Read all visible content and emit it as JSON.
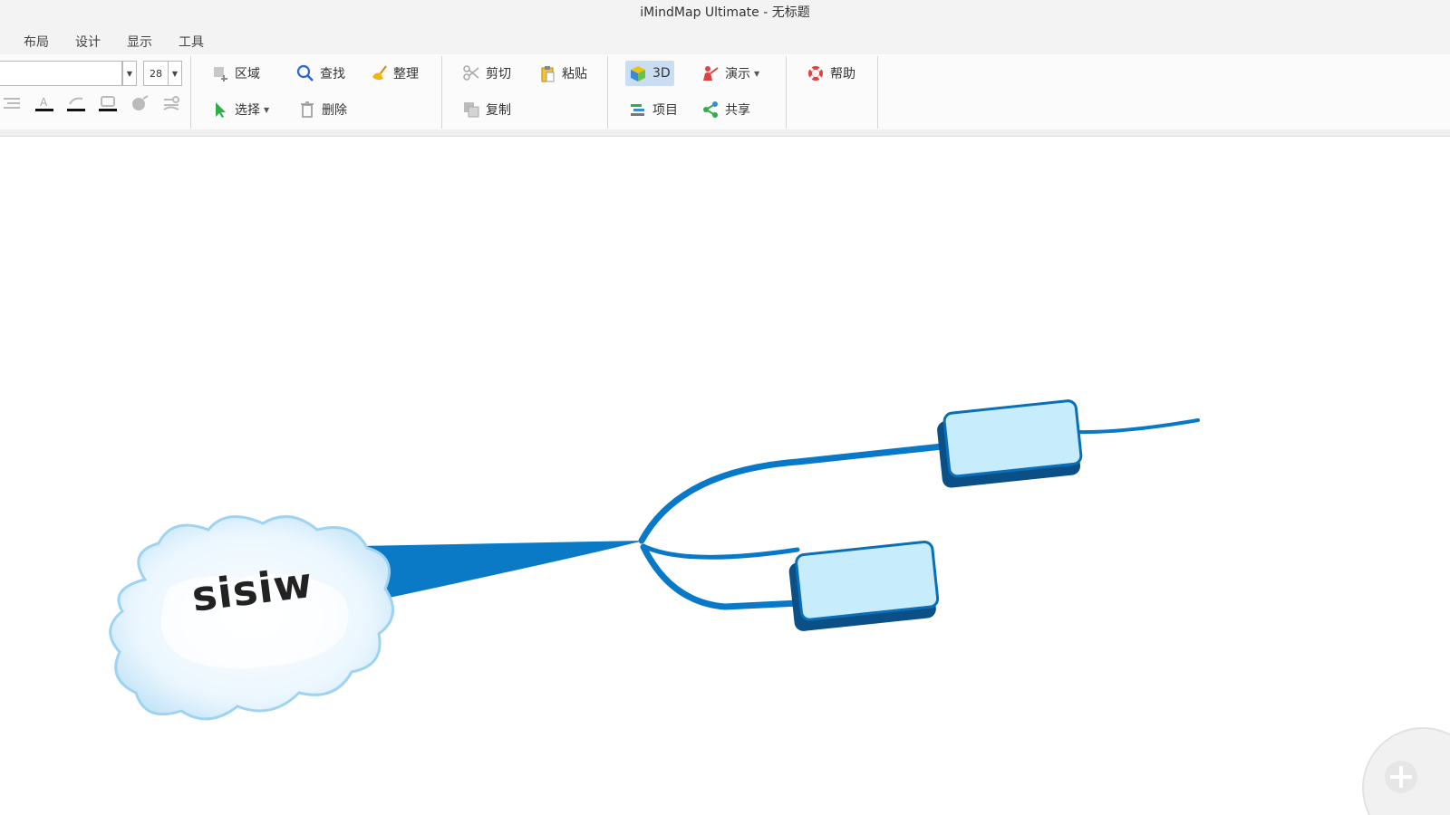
{
  "window": {
    "title": "iMindMap Ultimate - 无标题"
  },
  "menu": {
    "items": [
      "布局",
      "设计",
      "显示",
      "工具"
    ]
  },
  "ribbon": {
    "font_size": "28",
    "buttons": {
      "region": "区域",
      "find": "查找",
      "organize": "整理",
      "select": "选择",
      "delete": "删除",
      "cut": "剪切",
      "paste": "粘贴",
      "copy": "复制",
      "view3d": "3D",
      "present": "演示",
      "project": "项目",
      "share": "共享",
      "help": "帮助"
    }
  },
  "map": {
    "central_topic": "sisiw",
    "colors": {
      "branch": "#0879c8",
      "branch_dark": "#0a5e9c",
      "box_fill": "#c7ecfb",
      "box_edge": "#0a4f86"
    }
  }
}
